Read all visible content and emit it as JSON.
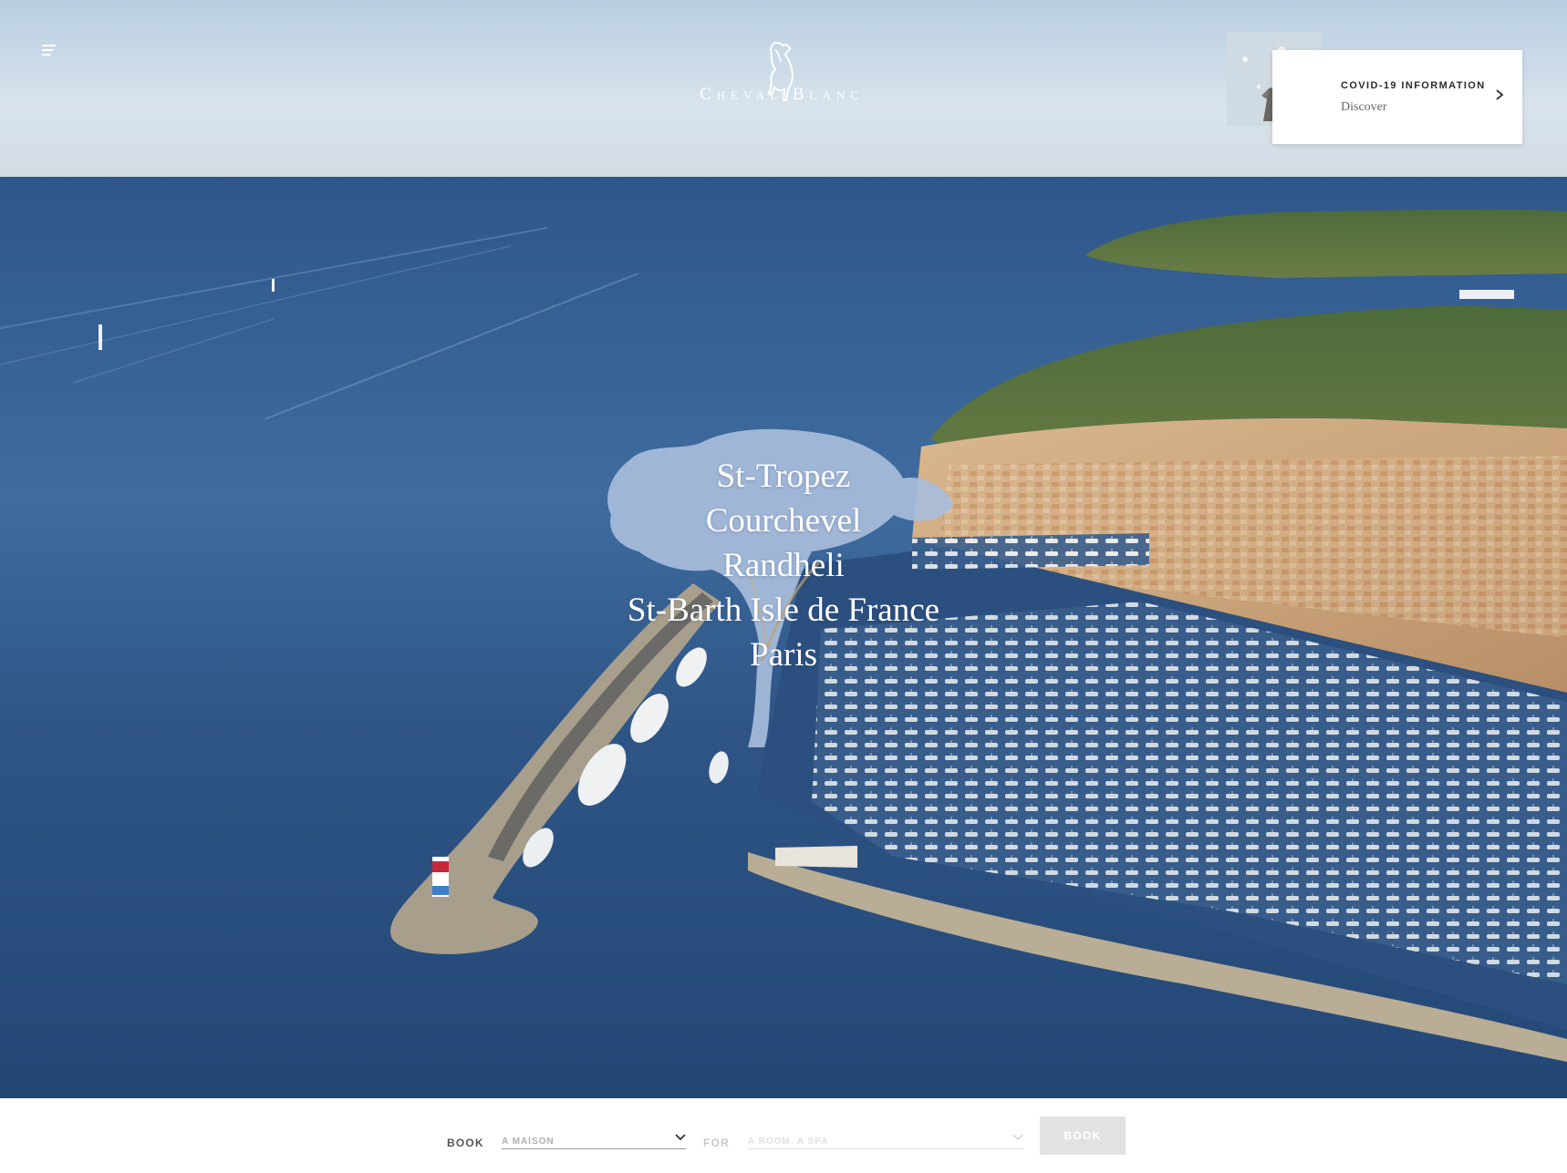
{
  "header": {
    "menu_icon": "hamburger-menu-icon",
    "logo_text": "Cheval Blanc"
  },
  "covid_card": {
    "title": "COVID-19 INFORMATION",
    "link": "Discover",
    "arrow_icon": "chevron-right-icon"
  },
  "destinations": [
    "St-Tropez",
    "Courchevel",
    "Randheli",
    "St-Barth Isle de France",
    "Paris"
  ],
  "booking": {
    "book_label": "BOOK",
    "maison_value": "A MAISON",
    "for_label": "FOR",
    "for_value": "A ROOM, A SPA",
    "button_label": "BOOK"
  },
  "colors": {
    "sea": "#2d5487",
    "sky": "#c9d8e6",
    "tree_overlay": "#9fb6d8",
    "button_bg": "#e2e2e2"
  }
}
